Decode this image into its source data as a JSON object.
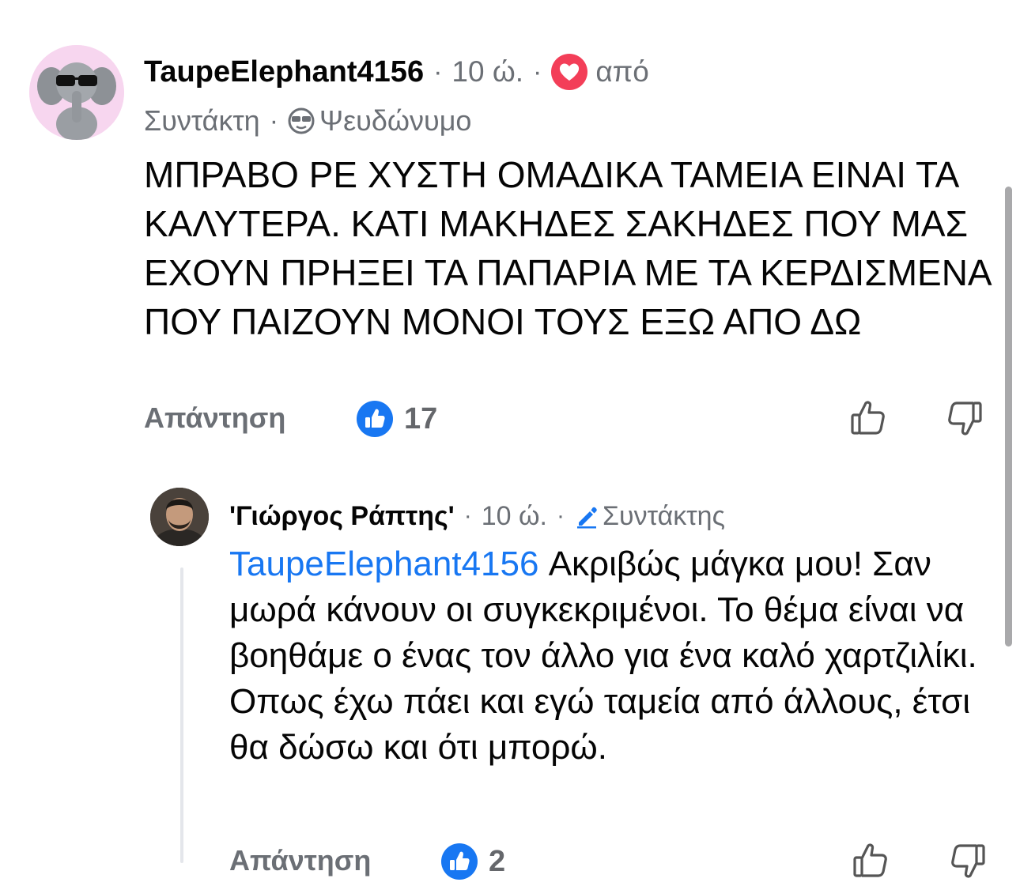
{
  "comment": {
    "author": "TaupeElephant4156",
    "time": "10 ώ.",
    "separator": "·",
    "liked_by_label": "από",
    "role": "Συντάκτη",
    "anon_label": "Ψευδώνυμο",
    "body": "ΜΠΡΑΒΟ ΡΕ ΧΥΣΤΗ ΟΜΑΔΙΚΑ ΤΑΜΕΙΑ ΕΙΝΑΙ ΤΑ ΚΑΛΥΤΕΡΑ. ΚΑΤΙ ΜΑΚΗΔΕΣ ΣΑΚΗΔΕΣ ΠΟΥ ΜΑΣ ΕΧΟΥΝ ΠΡΗΞΕΙ ΤΑ ΠΑΠΑΡΙΑ ΜΕ ΤΑ ΚΕΡΔΙΣΜΕΝΑ ΠΟΥ ΠΑΙΖΟΥΝ ΜΟΝΟΙ ΤΟΥΣ ΕΞΩ ΑΠΟ ΔΩ",
    "reply_label": "Απάντηση",
    "like_count": "17"
  },
  "reply": {
    "author": "'Γιώργος Ράπτης'",
    "time": "10 ώ.",
    "separator": "·",
    "role": "Συντάκτης",
    "mention": "TaupeElephant4156",
    "body": " Ακριβώς μάγκα μου! Σαν μωρά κάνουν οι συγκεκριμένοι. Το θέμα είναι να βοηθάμε ο ένας τον άλλο για ένα καλό χαρτζιλίκι. Οπως έχω πάει και εγώ ταμεία από άλλους, έτσι θα δώσω και ότι μπορώ.",
    "reply_label": "Απάντηση",
    "like_count": "2"
  },
  "colors": {
    "accent": "#1877f2",
    "heart": "#f33e58",
    "muted_text": "#6b6f75"
  },
  "icons": {
    "heart_badge": "heart-icon",
    "incognito": "sunglasses-face-icon",
    "like_badge": "thumbs-up-icon",
    "like_button": "thumbs-up-outline-icon",
    "dislike_button": "thumbs-down-outline-icon",
    "editor_badge": "pencil-icon"
  }
}
